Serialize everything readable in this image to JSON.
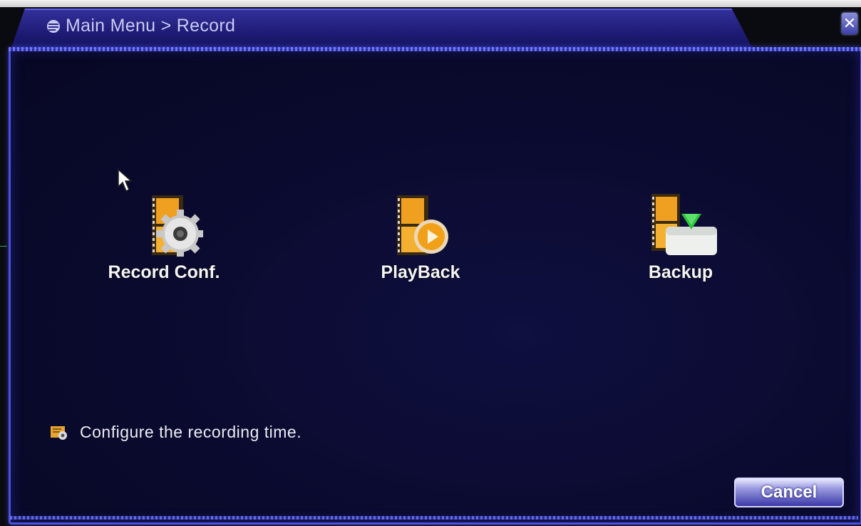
{
  "window": {
    "breadcrumb": "Main Menu > Record",
    "close_label": "✕"
  },
  "menu": {
    "items": [
      {
        "label": "Record Conf.",
        "icon": "film-gear-icon"
      },
      {
        "label": "PlayBack",
        "icon": "film-play-icon"
      },
      {
        "label": "Backup",
        "icon": "film-download-icon"
      }
    ]
  },
  "help": {
    "text": "Configure the recording time.",
    "icon": "info-tip-icon"
  },
  "footer": {
    "cancel_label": "Cancel"
  },
  "colors": {
    "frame": "#4b50e0",
    "background": "#0a0a2e",
    "film_orange": "#f0a020",
    "button_top": "#e8e8ff",
    "button_bottom": "#3b38a8"
  }
}
